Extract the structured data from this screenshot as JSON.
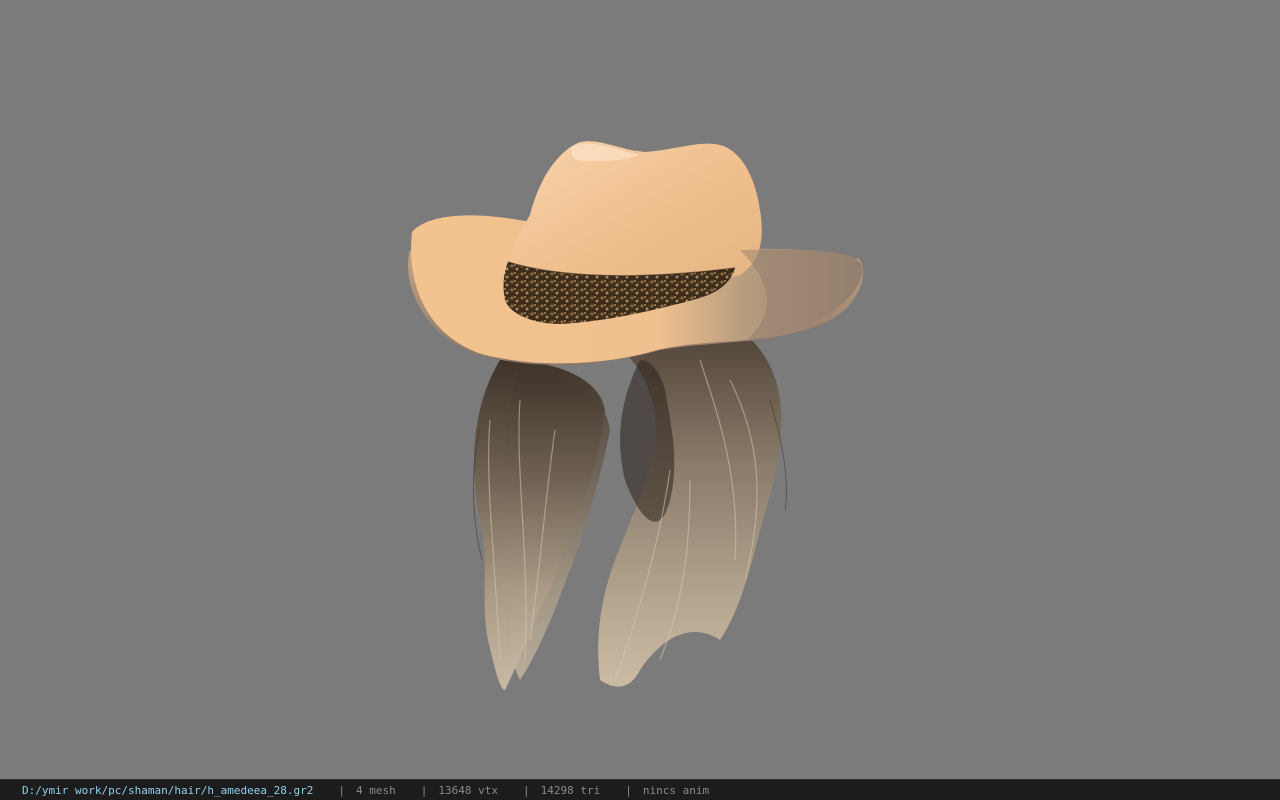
{
  "viewer": {
    "background_color": "#7b7b7b",
    "model_name": "h_amedeea_28"
  },
  "statusbar": {
    "file_path": "D:/ymir work/pc/shaman/hair/h_amedeea_28.gr2",
    "separator": "|",
    "mesh_count": "4 mesh",
    "vertex_count": "13648 vtx",
    "triangle_count": "14298 tri",
    "anim_status": "nincs anim",
    "path_color": "#8fd0ee",
    "text_color": "#8a8a8a"
  }
}
